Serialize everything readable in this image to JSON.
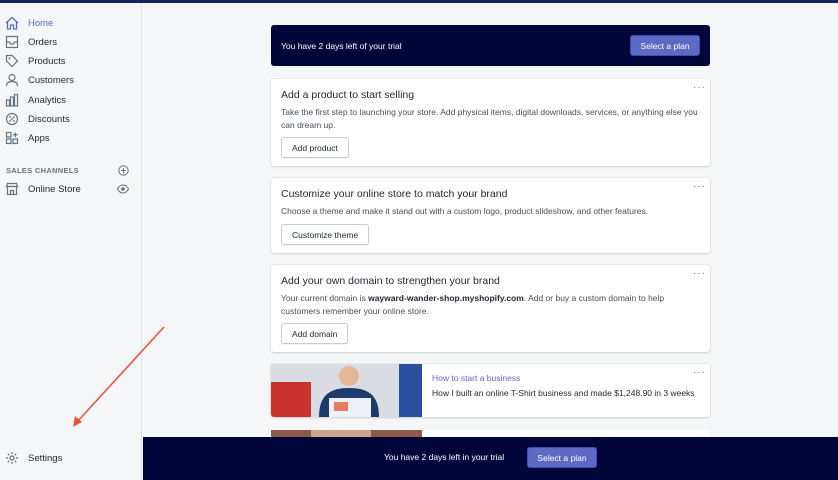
{
  "sidebar": {
    "items": [
      {
        "label": "Home",
        "icon": "home-icon",
        "active": true
      },
      {
        "label": "Orders",
        "icon": "orders-icon"
      },
      {
        "label": "Products",
        "icon": "tag-icon"
      },
      {
        "label": "Customers",
        "icon": "person-icon"
      },
      {
        "label": "Analytics",
        "icon": "bar-chart-icon"
      },
      {
        "label": "Discounts",
        "icon": "discount-icon"
      },
      {
        "label": "Apps",
        "icon": "apps-icon"
      }
    ],
    "sales_channels_heading": "SALES CHANNELS",
    "online_store": "Online Store",
    "settings": "Settings"
  },
  "trial_banner": {
    "text": "You have 2 days left of your trial",
    "button": "Select a plan"
  },
  "cards": [
    {
      "title": "Add a product to start selling",
      "desc": "Take the first step to launching your store. Add physical items, digital downloads, services, or anything else you can dream up.",
      "button": "Add product"
    },
    {
      "title": "Customize your online store to match your brand",
      "desc": "Choose a theme and make it stand out with a custom logo, product slideshow, and other features.",
      "button": "Customize theme"
    },
    {
      "title": "Add your own domain to strengthen your brand",
      "desc_prefix": "Your current domain is ",
      "desc_domain": "wayward-wander-shop.myshopify.com",
      "desc_suffix": ". Add or buy a custom domain to help customers remember your online store.",
      "button": "Add domain"
    }
  ],
  "blog": {
    "link": "How to start a business",
    "text": "How I built an online T-Shirt business and made $1,248.90 in 3 weeks"
  },
  "bottom_bar": {
    "text": "You have 2 days left in your trial",
    "button": "Select a plan"
  },
  "more_glyph": "···",
  "colors": {
    "accent": "#5c6ac4",
    "banner": "#000639",
    "arrow": "#e8553b"
  }
}
